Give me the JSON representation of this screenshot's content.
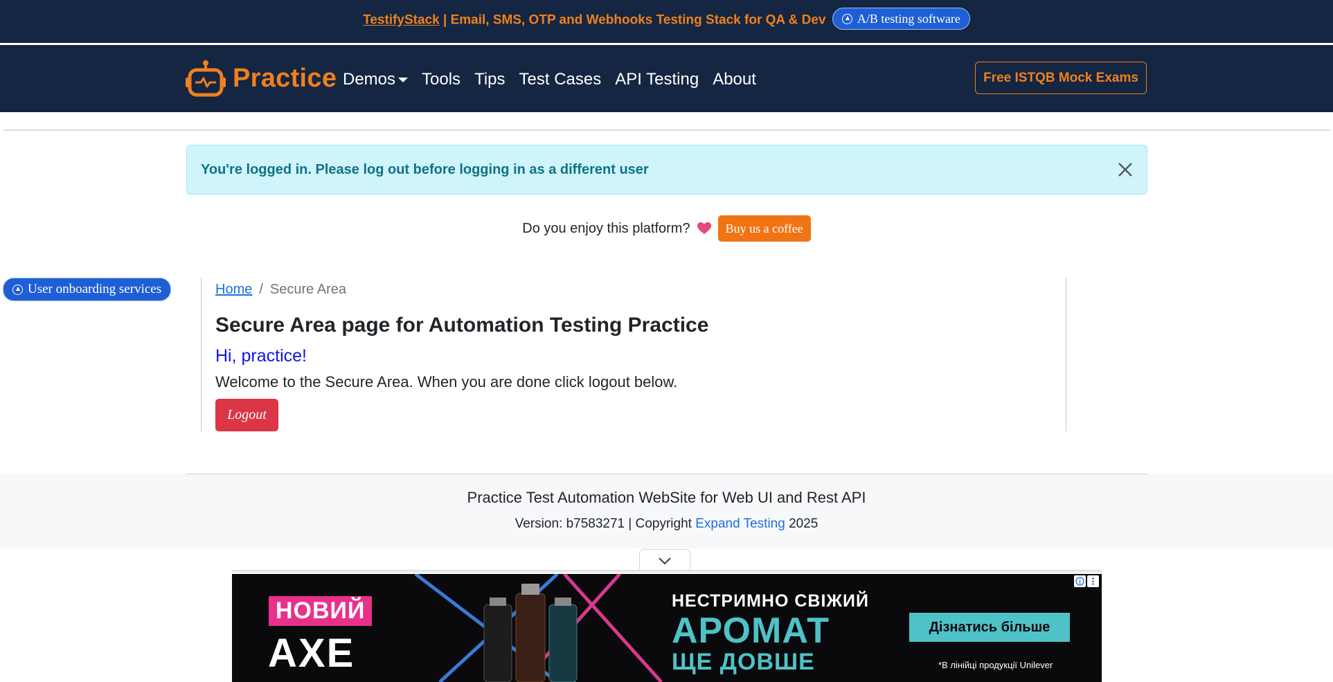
{
  "promo": {
    "brand_link": "TestifyStack",
    "text": " | Email, SMS, OTP and Webhooks Testing Stack for QA & Dev",
    "pill_label": "A/B testing software"
  },
  "navbar": {
    "brand": "Practice",
    "links": [
      {
        "label": "Demos",
        "dropdown": true
      },
      {
        "label": "Tools"
      },
      {
        "label": "Tips"
      },
      {
        "label": "Test Cases"
      },
      {
        "label": "API Testing"
      },
      {
        "label": "About"
      }
    ],
    "exam_button": "Free ISTQB Mock Exams"
  },
  "alert": {
    "message": "You're logged in. Please log out before logging in as a different user"
  },
  "coffee": {
    "question": "Do you enjoy this platform?",
    "button": "Buy us a coffee"
  },
  "side_pill": {
    "label": "User onboarding services"
  },
  "breadcrumb": {
    "home": "Home",
    "separator": "/",
    "current": "Secure Area"
  },
  "main": {
    "title": "Secure Area page for Automation Testing Practice",
    "greeting": "Hi, practice!",
    "welcome": "Welcome to the Secure Area. When you are done click logout below.",
    "logout_button": "Logout"
  },
  "footer": {
    "title": "Practice Test Automation WebSite for Web UI and Rest API",
    "version_prefix": "Version: b7583271 | Copyright ",
    "copyright_link": "Expand Testing",
    "year": " 2025"
  },
  "ad": {
    "badge": "НОВИЙ",
    "brand": "AXE",
    "headline_1": "НЕСТРИМНО СВІЖИЙ",
    "headline_2": "АРОМАТ",
    "headline_3": "ЩЕ ДОВШЕ",
    "cta": "Дізнатись більше",
    "note": "*В лінійці продукції Unilever"
  },
  "colors": {
    "navy": "#142641",
    "accent_orange": "#f0801e",
    "alert_bg": "#cff4fc",
    "alert_text": "#0e7383",
    "logout_red": "#dc3545",
    "greeting_blue": "#1313e8",
    "link_blue": "#1d6fe0"
  }
}
